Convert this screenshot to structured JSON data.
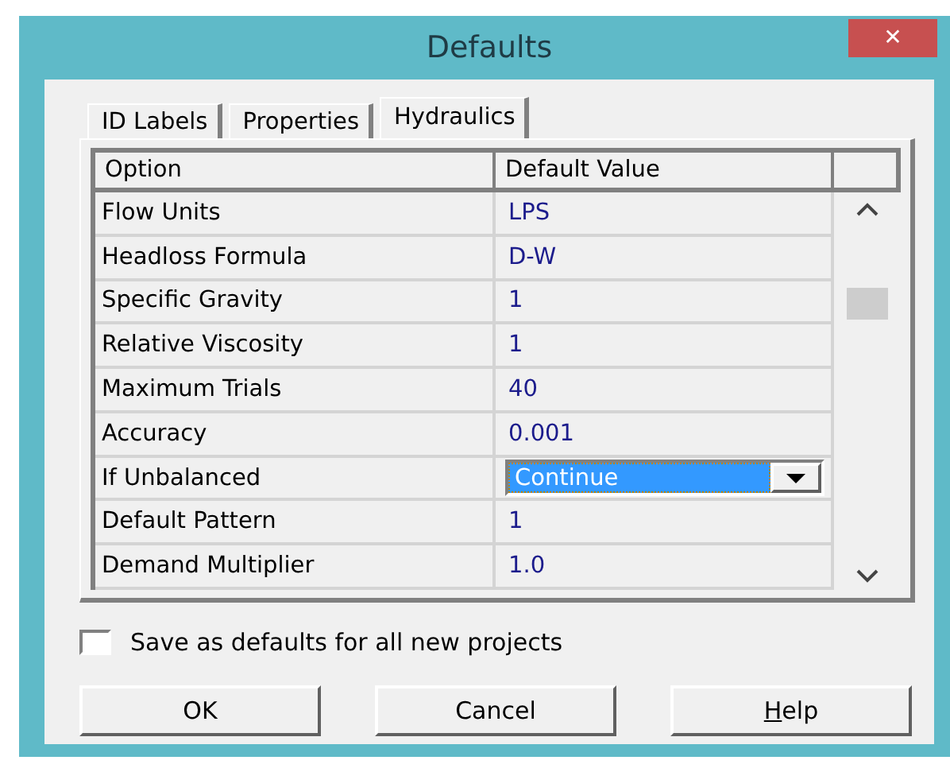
{
  "window": {
    "title": "Defaults",
    "close": "✕"
  },
  "tabs": [
    {
      "label": "ID Labels",
      "selected": false
    },
    {
      "label": "Properties",
      "selected": false
    },
    {
      "label": "Hydraulics",
      "selected": true
    }
  ],
  "grid": {
    "columns": [
      "Option",
      "Default Value"
    ],
    "rows": [
      {
        "option": "Flow Units",
        "value": "LPS",
        "kind": "text"
      },
      {
        "option": "Headloss Formula",
        "value": "D-W",
        "kind": "text"
      },
      {
        "option": "Specific Gravity",
        "value": "1",
        "kind": "text"
      },
      {
        "option": "Relative Viscosity",
        "value": "1",
        "kind": "text"
      },
      {
        "option": "Maximum Trials",
        "value": "40",
        "kind": "text"
      },
      {
        "option": "Accuracy",
        "value": "0.001",
        "kind": "text"
      },
      {
        "option": "If Unbalanced",
        "value": "Continue",
        "kind": "dropdown"
      },
      {
        "option": "Default Pattern",
        "value": "1",
        "kind": "text"
      },
      {
        "option": "Demand Multiplier",
        "value": "1.0",
        "kind": "text"
      }
    ]
  },
  "save_defaults": {
    "label": "Save as defaults for all new projects",
    "checked": false
  },
  "buttons": [
    {
      "label": "OK",
      "first_letter_underlined": false
    },
    {
      "label": "Cancel",
      "first_letter_underlined": false
    },
    {
      "label": "Help",
      "first_letter_underlined": true
    }
  ]
}
